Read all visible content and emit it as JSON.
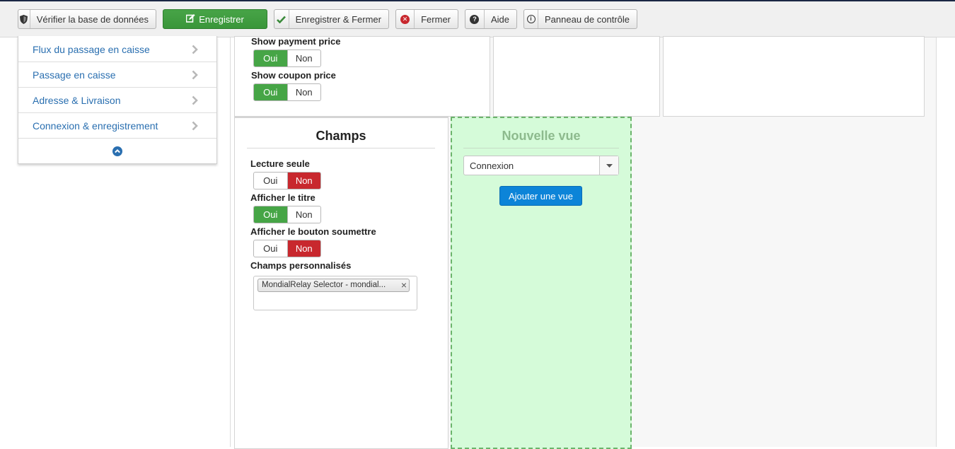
{
  "toolbar": {
    "check_db": "Vérifier la base de données",
    "save": "Enregistrer",
    "save_close": "Enregistrer & Fermer",
    "close": "Fermer",
    "help": "Aide",
    "control_panel": "Panneau de contrôle"
  },
  "sidebar": {
    "items": [
      {
        "label": "Flux du passage en caisse"
      },
      {
        "label": "Passage en caisse"
      },
      {
        "label": "Adresse & Livraison"
      },
      {
        "label": "Connexion & enregistrement"
      }
    ]
  },
  "upper_fields": [
    {
      "label": "Show payment price",
      "yes": "Oui",
      "no": "Non",
      "value": "Oui"
    },
    {
      "label": "Show coupon price",
      "yes": "Oui",
      "no": "Non",
      "value": "Oui"
    }
  ],
  "champs": {
    "title": "Champs",
    "fields": [
      {
        "label": "Lecture seule",
        "yes": "Oui",
        "no": "Non",
        "value": "Non"
      },
      {
        "label": "Afficher le titre",
        "yes": "Oui",
        "no": "Non",
        "value": "Oui"
      },
      {
        "label": "Afficher le bouton soumettre",
        "yes": "Oui",
        "no": "Non",
        "value": "Non"
      }
    ],
    "custom_label": "Champs personnalisés",
    "custom_tags": [
      "MondialRelay Selector - mondial..."
    ]
  },
  "new_view": {
    "title": "Nouvelle vue",
    "select_value": "Connexion",
    "add_button": "Ajouter une vue"
  },
  "colors": {
    "yes_active": "#46a546",
    "no_active": "#c8282e",
    "link": "#2a6fb0",
    "primary_blue": "#0c84d8",
    "dropzone": "#d5fbd9"
  }
}
